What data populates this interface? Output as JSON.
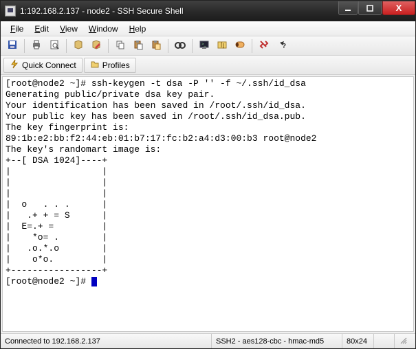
{
  "window": {
    "title": "1:192.168.2.137 - node2 - SSH Secure Shell",
    "min_label": "_",
    "max_label": "□",
    "close_label": "X"
  },
  "menu": {
    "file_pre": "F",
    "file_rest": "ile",
    "edit_pre": "E",
    "edit_rest": "dit",
    "view_pre": "V",
    "view_rest": "iew",
    "window_pre": "W",
    "window_rest": "indow",
    "help_pre": "H",
    "help_rest": "elp"
  },
  "toolbar": {
    "icons": {
      "save": "save-icon",
      "print": "print-icon",
      "preview": "print-preview-icon",
      "newprofile": "new-profile-icon",
      "editprofile": "edit-profile-icon",
      "copy": "copy-icon",
      "paste": "paste-icon",
      "paste2": "paste-selection-icon",
      "find": "find-icon",
      "newterm": "new-terminal-icon",
      "newft": "new-file-transfer-icon",
      "tunnel": "tunnel-icon",
      "disconnect": "disconnect-icon",
      "help": "help-icon"
    }
  },
  "quickbar": {
    "connect_label": "Quick Connect",
    "profiles_label": "Profiles"
  },
  "terminal": {
    "lines": [
      "[root@node2 ~]# ssh-keygen -t dsa -P '' -f ~/.ssh/id_dsa",
      "Generating public/private dsa key pair.",
      "Your identification has been saved in /root/.ssh/id_dsa.",
      "Your public key has been saved in /root/.ssh/id_dsa.pub.",
      "The key fingerprint is:",
      "89:1b:e2:bb:f2:44:eb:01:b7:17:fc:b2:a4:d3:00:b3 root@node2",
      "The key's randomart image is:",
      "+--[ DSA 1024]----+",
      "|                 |",
      "|                 |",
      "|                 |",
      "|  o   . . .      |",
      "|   .+ + = S      |",
      "|  E=.+ =         |",
      "|    *o= .        |",
      "|   .o.*.o        |",
      "|    o*o.         |",
      "+-----------------+"
    ],
    "prompt": "[root@node2 ~]# "
  },
  "status": {
    "left": "Connected to 192.168.2.137",
    "center": "SSH2 - aes128-cbc - hmac-md5",
    "size": "80x24"
  }
}
